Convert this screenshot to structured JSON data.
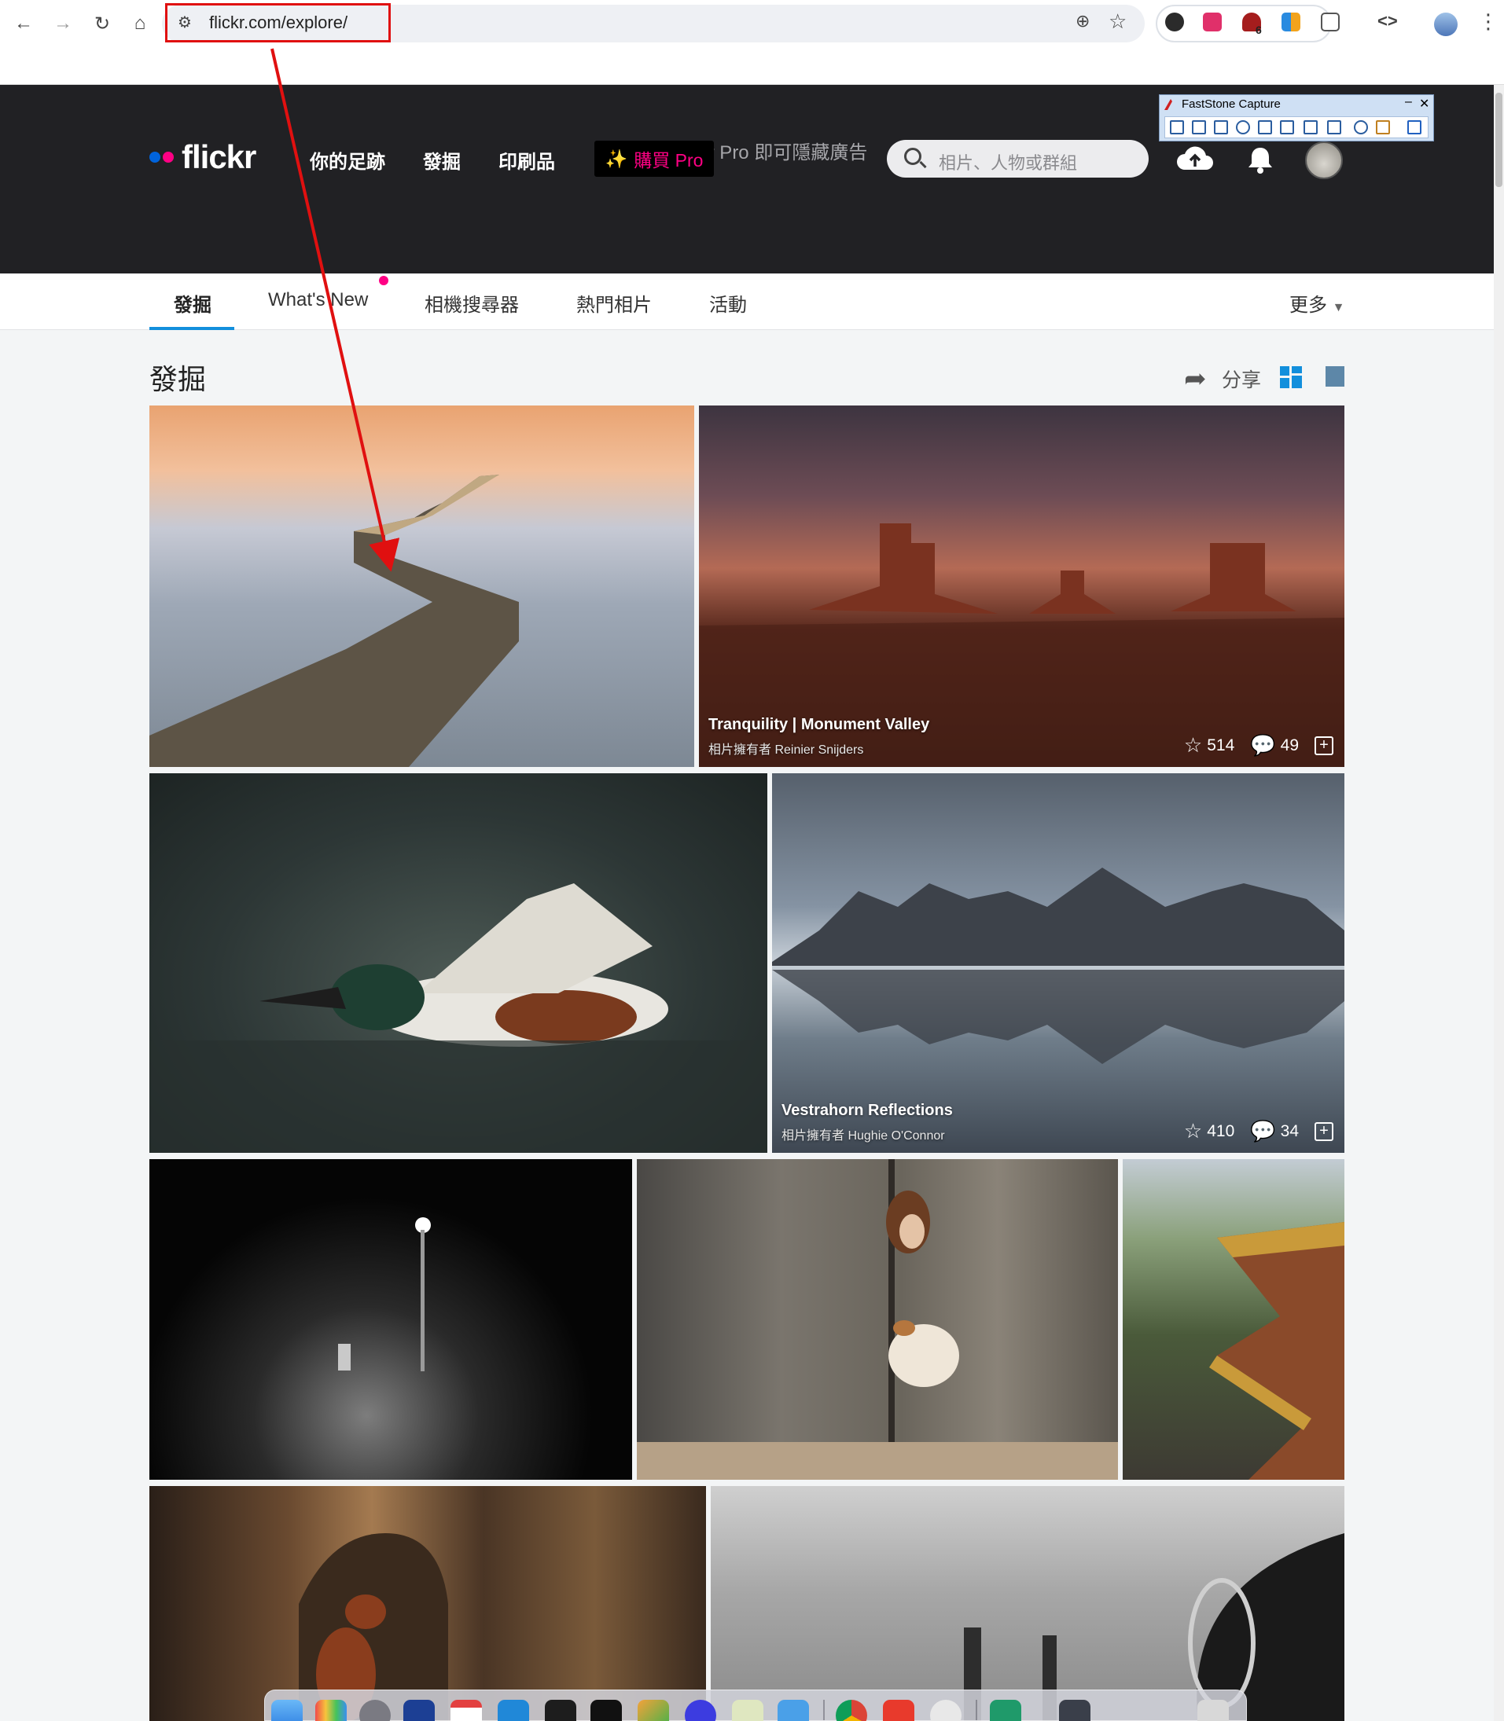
{
  "browser": {
    "url": "flickr.com/explore/",
    "extension_badge": "6"
  },
  "ad": {
    "text": "升級 Flickr Pro 即可隱藏廣告"
  },
  "header": {
    "logo": "flickr",
    "nav": [
      "你的足跡",
      "發掘",
      "印刷品"
    ],
    "buy_pro_label": "購買 Pro",
    "search_placeholder": "相片、人物或群組"
  },
  "subnav": {
    "tabs": [
      "發掘",
      "What's New",
      "相機搜尋器",
      "熱門相片",
      "活動"
    ],
    "more_label": "更多"
  },
  "page": {
    "title": "發掘",
    "share_label": "分享"
  },
  "photos": [
    {
      "title": "Tranquility | Monument Valley",
      "owner": "相片擁有者 Reinier Snijders",
      "faves": "514",
      "comments": "49"
    },
    {
      "title": "Vestrahorn Reflections",
      "owner": "相片擁有者 Hughie O'Connor",
      "faves": "410",
      "comments": "34"
    }
  ],
  "faststone": {
    "title": "FastStone Capture"
  },
  "icons": {
    "back": "arrow-left",
    "forward": "arrow-right",
    "reload": "reload",
    "home": "home",
    "search": "magnifier",
    "upload": "cloud-upload",
    "notifications": "bell",
    "share": "share-arrow",
    "fave": "star",
    "comment": "speech-bubble",
    "add": "plus-square"
  },
  "colors": {
    "flickr_blue": "#0063dc",
    "flickr_pink": "#ff0084",
    "header_bg": "#212124",
    "tab_accent": "#128fdc",
    "annotation_red": "#e01010"
  }
}
